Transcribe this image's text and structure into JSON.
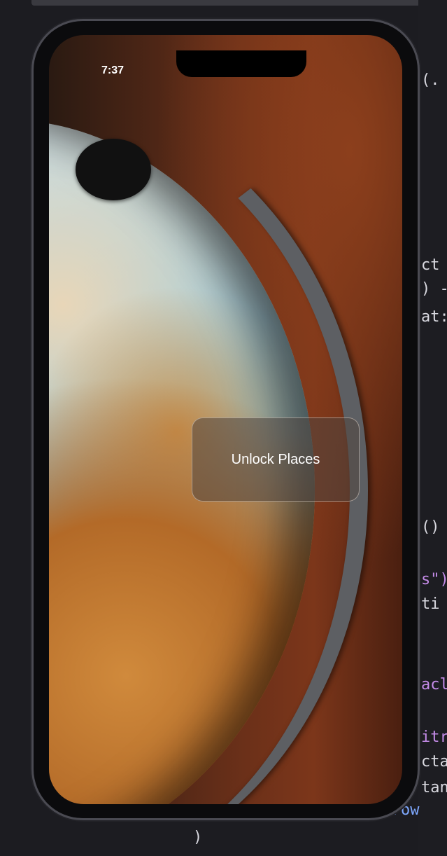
{
  "status_bar": {
    "time": "7:37"
  },
  "main": {
    "unlock_button_label": "Unlock Places"
  },
  "ide_background": {
    "code_lines": [
      "(.",
      "ct",
      ") -",
      "at:",
      "()",
      "s\")",
      "ti",
      "acl",
      "itr",
      "cta",
      "tang"
    ],
    "bottom_code": "(.brow",
    "bottom_paren": ")"
  }
}
